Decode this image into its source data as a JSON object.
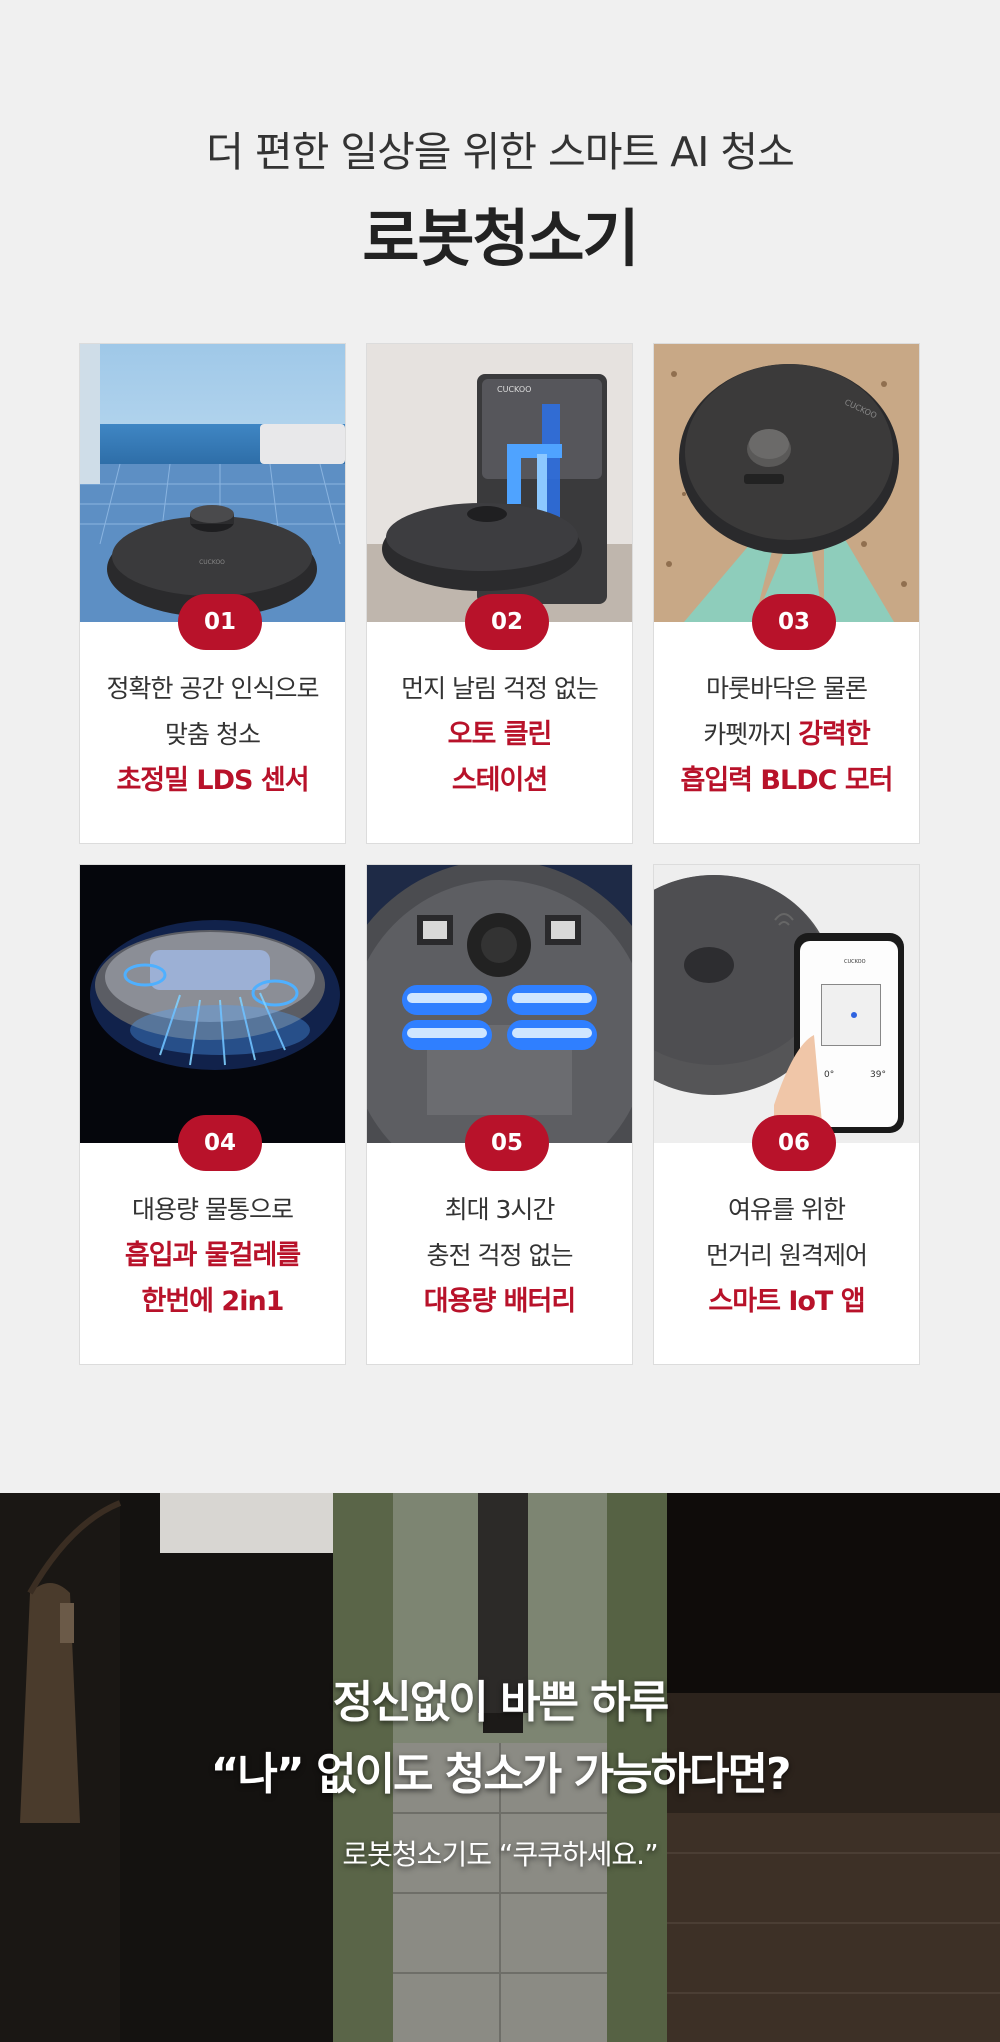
{
  "header": {
    "subtitle": "더 편한 일상을 위한 스마트 AI 청소",
    "title": "로봇청소기"
  },
  "cards": [
    {
      "number": "01",
      "lines": [
        "정확한 공간 인식으로",
        "맞춤 청소"
      ],
      "highlight": "초정밀 LDS 센서"
    },
    {
      "number": "02",
      "lines": [
        "먼지 날림 걱정 없는"
      ],
      "highlight_lines": [
        "오토 클린",
        "스테이션"
      ]
    },
    {
      "number": "03",
      "lines": [
        "마룻바닥은 물론"
      ],
      "mixed_prefix": "카펫까지 ",
      "mixed_highlight": "강력한",
      "highlight": "흡입력 BLDC 모터"
    },
    {
      "number": "04",
      "lines": [
        "대용량 물통으로"
      ],
      "highlight_lines": [
        "흡입과 물걸레를",
        "한번에 2in1"
      ]
    },
    {
      "number": "05",
      "lines": [
        "최대 3시간",
        "충전 걱정 없는"
      ],
      "highlight": "대용량 배터리"
    },
    {
      "number": "06",
      "lines": [
        "여유를 위한",
        "먼거리 원격제어"
      ],
      "highlight": "스마트 IoT 앱"
    }
  ],
  "images": {
    "logo_text": "CUCKOO",
    "phone_temp": "39°",
    "phone_zero": "0°"
  },
  "bottom": {
    "line1": "정신없이 바쁜 하루",
    "line2": "“나” 없이도 청소가 가능하다면?",
    "line3": "로봇청소기도 “쿠쿠하세요.”"
  },
  "colors": {
    "accent": "#b8122a",
    "background": "#f0f0f0"
  }
}
